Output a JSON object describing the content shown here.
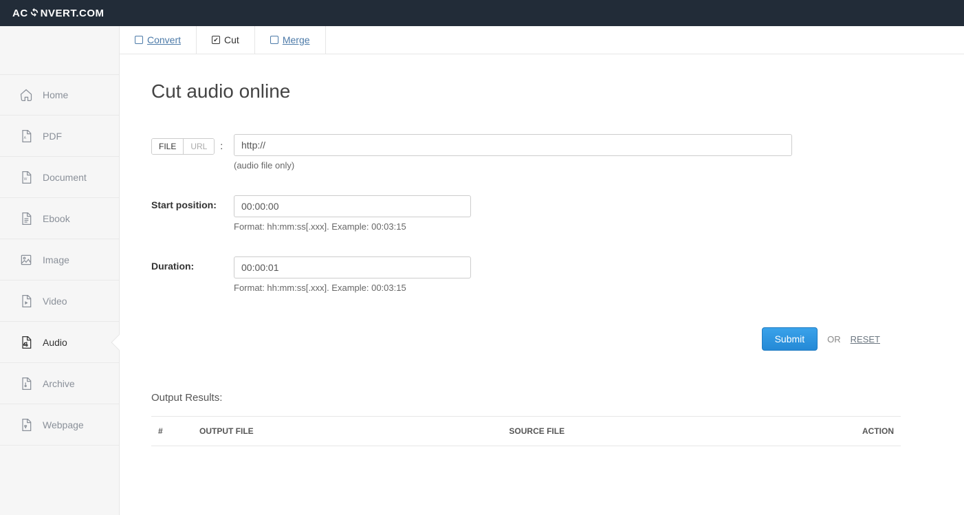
{
  "brand": {
    "pre": "AC",
    "post": "NVERT.COM"
  },
  "sidebar": {
    "items": [
      {
        "label": "Home"
      },
      {
        "label": "PDF"
      },
      {
        "label": "Document"
      },
      {
        "label": "Ebook"
      },
      {
        "label": "Image"
      },
      {
        "label": "Video"
      },
      {
        "label": "Audio"
      },
      {
        "label": "Archive"
      },
      {
        "label": "Webpage"
      }
    ]
  },
  "tabs": {
    "convert": "Convert",
    "cut": "Cut",
    "merge": "Merge"
  },
  "page": {
    "title": "Cut audio online"
  },
  "source": {
    "file_btn": "FILE",
    "url_btn": "URL",
    "colon": ":",
    "url_value": "http://",
    "hint": "(audio file only)"
  },
  "start": {
    "label": "Start position:",
    "value": "00:00:00",
    "hint": "Format: hh:mm:ss[.xxx]. Example: 00:03:15"
  },
  "duration": {
    "label": "Duration:",
    "value": "00:00:01",
    "hint": "Format: hh:mm:ss[.xxx]. Example: 00:03:15"
  },
  "actions": {
    "submit": "Submit",
    "or": "OR",
    "reset": "RESET"
  },
  "results": {
    "title": "Output Results:",
    "cols": {
      "num": "#",
      "output": "OUTPUT FILE",
      "source": "SOURCE FILE",
      "action": "ACTION"
    }
  }
}
